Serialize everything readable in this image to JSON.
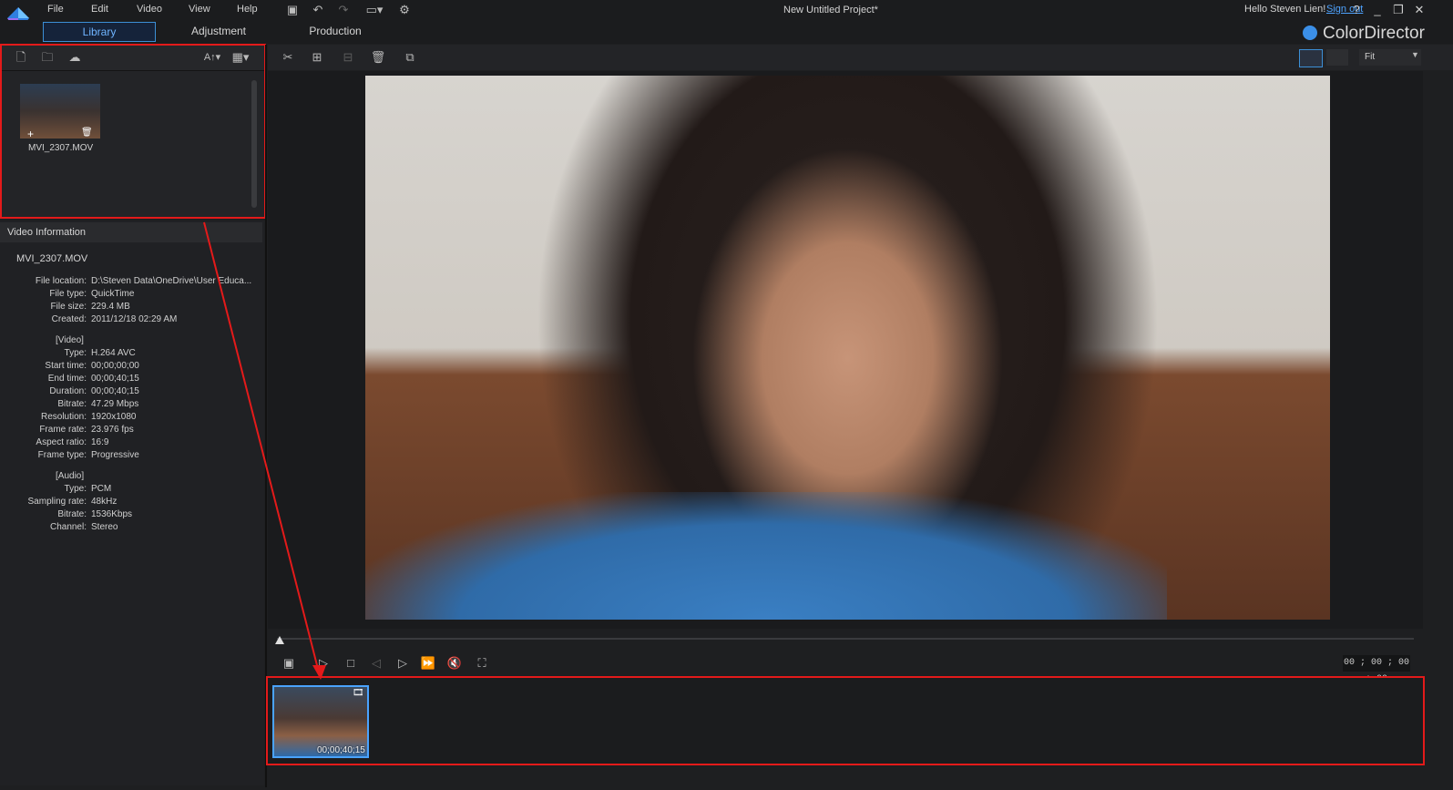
{
  "menu": {
    "items": [
      "File",
      "Edit",
      "Video",
      "View",
      "Help"
    ]
  },
  "titlebar": {
    "project_title": "New Untitled Project*",
    "greeting": "Hello Steven Lien!",
    "signout": "Sign out",
    "help": "?"
  },
  "tabs": {
    "library": "Library",
    "adjustment": "Adjustment",
    "production": "Production"
  },
  "brand": "ColorDirector",
  "library": {
    "item_label": "MVI_2307.MOV",
    "sort_label": "A↑▾"
  },
  "video_info": {
    "title": "Video Information",
    "file_name": "MVI_2307.MOV",
    "general": [
      {
        "k": "File location:",
        "v": "D:\\Steven Data\\OneDrive\\User Educa..."
      },
      {
        "k": "File type:",
        "v": "QuickTime"
      },
      {
        "k": "File size:",
        "v": "229.4 MB"
      },
      {
        "k": "Created:",
        "v": "2011/12/18 02:29 AM"
      }
    ],
    "video_section": "[Video]",
    "video": [
      {
        "k": "Type:",
        "v": "H.264 AVC"
      },
      {
        "k": "Start time:",
        "v": "00;00;00;00"
      },
      {
        "k": "End time:",
        "v": "00;00;40;15"
      },
      {
        "k": "Duration:",
        "v": "00;00;40;15"
      },
      {
        "k": "Bitrate:",
        "v": "47.29 Mbps"
      },
      {
        "k": "Resolution:",
        "v": "1920x1080"
      },
      {
        "k": "Frame rate:",
        "v": "23.976 fps"
      },
      {
        "k": "Aspect ratio:",
        "v": "16:9"
      },
      {
        "k": "Frame type:",
        "v": "Progressive"
      }
    ],
    "audio_section": "[Audio]",
    "audio": [
      {
        "k": "Type:",
        "v": "PCM"
      },
      {
        "k": "Sampling rate:",
        "v": "48kHz"
      },
      {
        "k": "Bitrate:",
        "v": "1536Kbps"
      },
      {
        "k": "Channel:",
        "v": "Stereo"
      }
    ]
  },
  "preview": {
    "fit_label": "Fit",
    "timecode": "00 ; 00 ; 00 ; 00"
  },
  "filmstrip": {
    "thumb_time": "00;00;40;15"
  },
  "colors": {
    "accent": "#3c8fd6",
    "annotation": "#e31a1a",
    "link": "#4ea3ff"
  }
}
